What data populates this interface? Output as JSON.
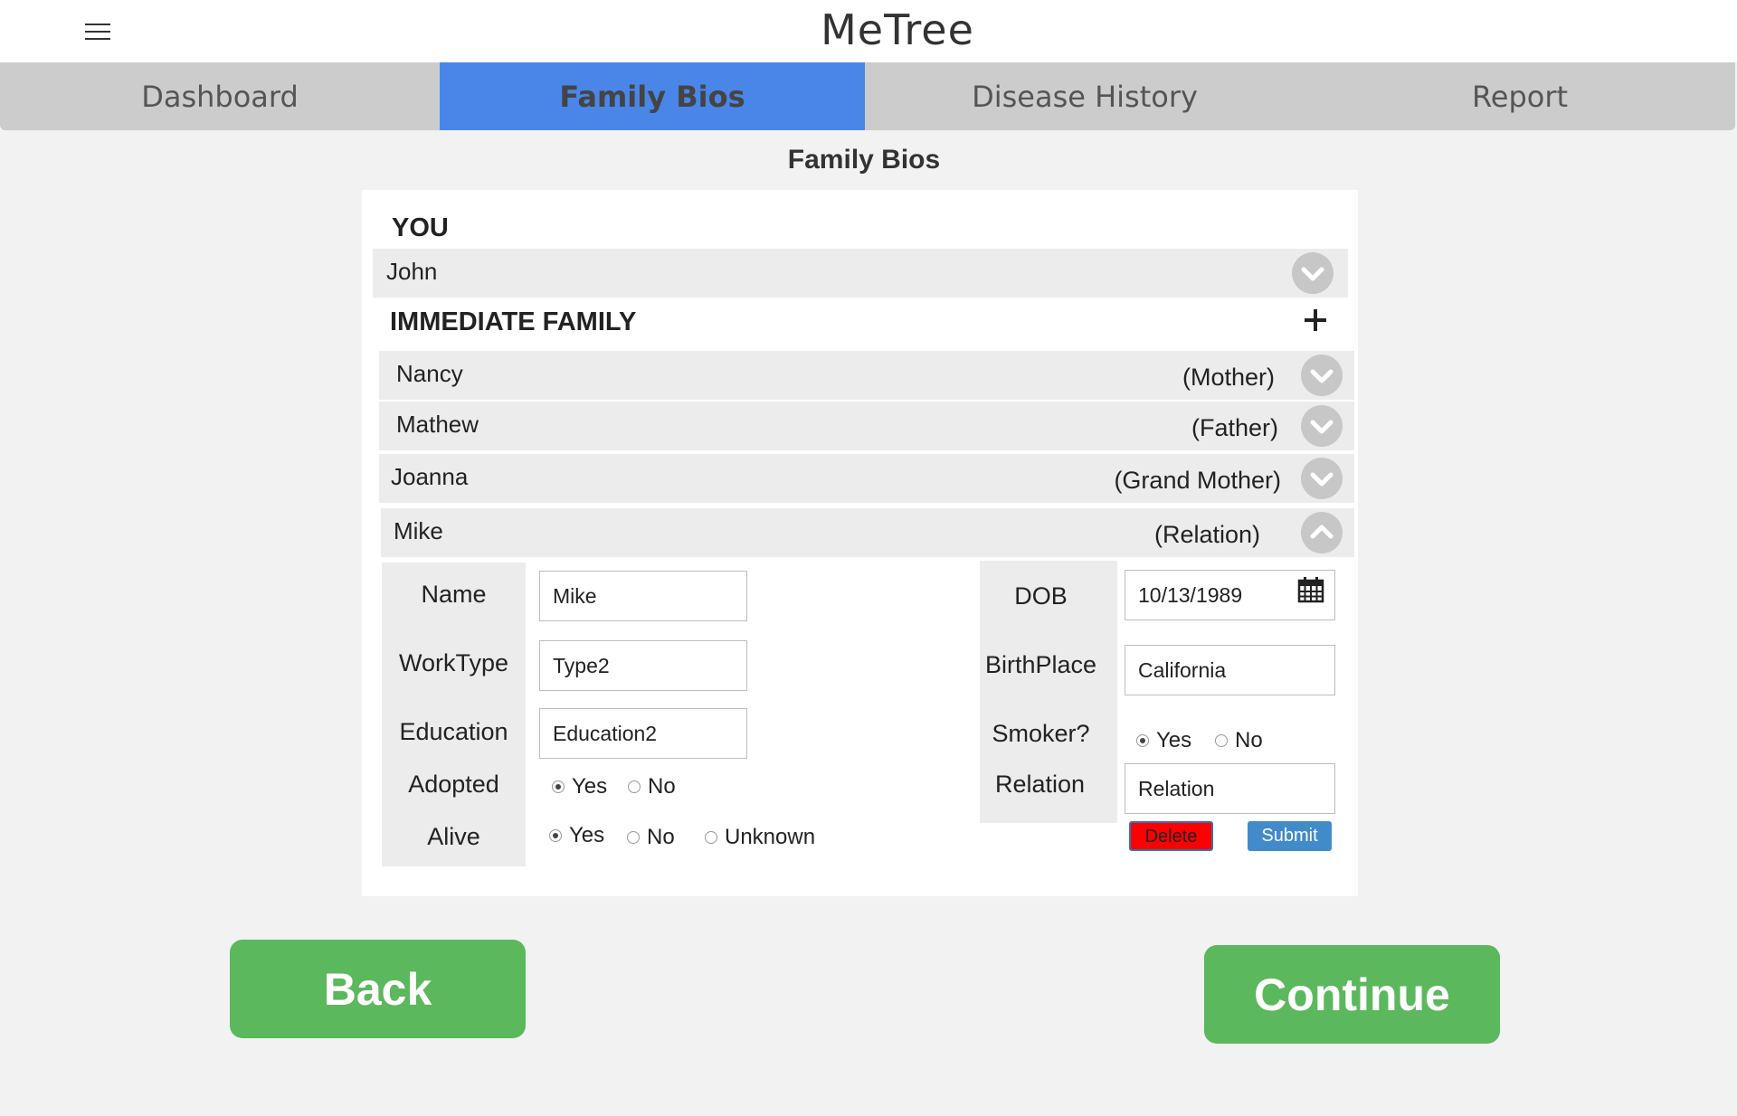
{
  "app": {
    "title": "MeTree"
  },
  "tabs": [
    {
      "label": "Dashboard",
      "active": false
    },
    {
      "label": "Family Bios",
      "active": true
    },
    {
      "label": "Disease History",
      "active": false
    },
    {
      "label": "Report",
      "active": false
    }
  ],
  "heading": "Family Bios",
  "you": {
    "section_label": "YOU",
    "name": "John"
  },
  "immediate_family": {
    "section_label": "IMMEDIATE FAMILY",
    "members": [
      {
        "name": "Nancy",
        "relation": "(Mother)",
        "expanded": false
      },
      {
        "name": "Mathew",
        "relation": "(Father)",
        "expanded": false
      },
      {
        "name": "Joanna",
        "relation": "(Grand Mother)",
        "expanded": false
      },
      {
        "name": "Mike",
        "relation": "(Relation)",
        "expanded": true
      }
    ]
  },
  "detail": {
    "name_label": "Name",
    "name_value": "Mike",
    "worktype_label": "WorkType",
    "worktype_value": "Type2",
    "education_label": "Education",
    "education_value": "Education2",
    "adopted_label": "Adopted",
    "adopted_options": [
      "Yes",
      "No"
    ],
    "adopted_selected": "Yes",
    "alive_label": "Alive",
    "alive_options": [
      "Yes",
      "No",
      "Unknown"
    ],
    "alive_selected": "Yes",
    "dob_label": "DOB",
    "dob_value": "10/13/1989",
    "birthplace_label": "BirthPlace",
    "birthplace_value": "California",
    "smoker_label": "Smoker?",
    "smoker_options": [
      "Yes",
      "No"
    ],
    "smoker_selected": "Yes",
    "relation_label": "Relation",
    "relation_value": "Relation",
    "delete_label": "Delete",
    "submit_label": "Submit"
  },
  "footer": {
    "back_label": "Back",
    "continue_label": "Continue"
  },
  "colors": {
    "active_tab": "#4a86e8",
    "tab_bar": "#cccccc",
    "primary_button": "#5cb85c",
    "delete_button": "#ff0000",
    "submit_button": "#428bca"
  }
}
